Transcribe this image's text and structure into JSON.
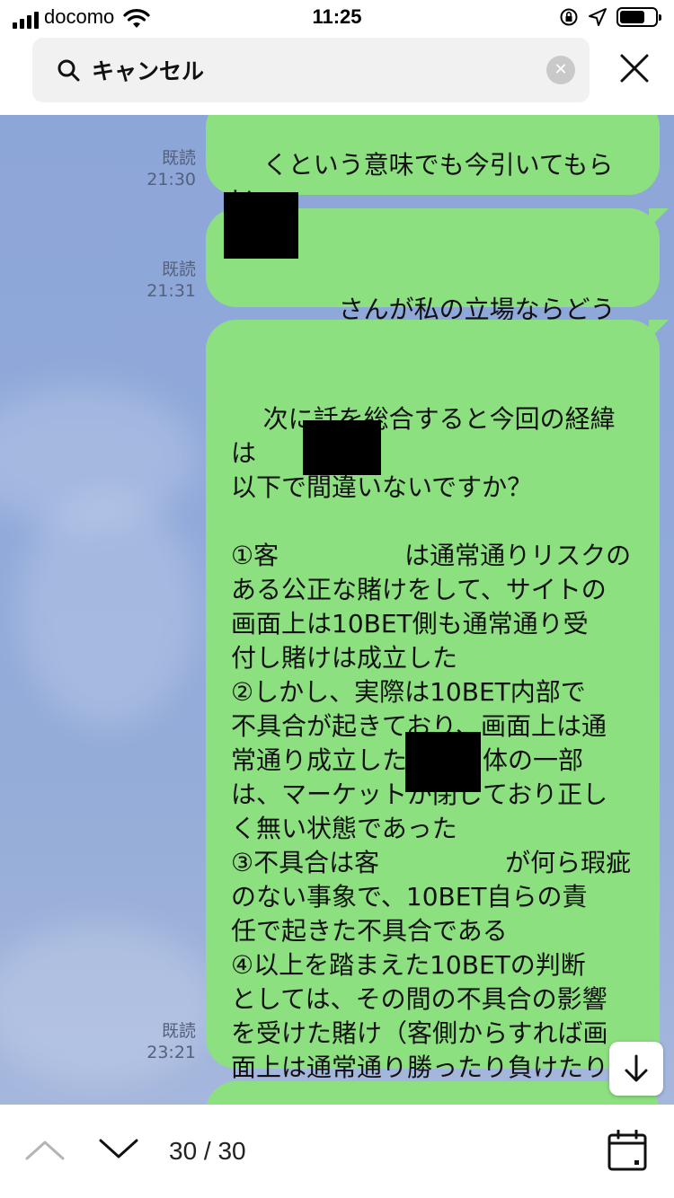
{
  "status_bar": {
    "carrier": "docomo",
    "time": "11:25",
    "battery_level": 0.7
  },
  "search": {
    "query": "キャンセル",
    "clear_icon": "clear-icon",
    "close_icon": "close-icon"
  },
  "messages": [
    {
      "read_label": "既読",
      "time": "21:30",
      "text": "くという意味でも今引いてもらい\nます。"
    },
    {
      "read_label": "既読",
      "time": "21:31",
      "text": "　　　さんが私の立場ならどうしま\nすか？"
    },
    {
      "read_label": "既読",
      "time": "23:21",
      "text": "次に話を総合すると今回の経緯は\n以下で間違いないですか？\n\n①客　　　　　は通常通りリスクの\nある公正な賭けをして、サイトの\n画面上は10BET側も通常通り受\n付し賭けは成立した\n②しかし、実際は10BET内部で\n不具合が起きており、画面上は通\n常通り成立した賭け自体の一部\nは、マーケットが閉じており正し\nく無い状態であった\n③不具合は客　　　　　が何ら瑕疵\nのない事象で、10BET自らの責\n任で起きた不具合である\n④以上を踏まえた10BETの判断\nとしては、その間の不具合の影響\nを受けた賭け（客側からすれば画\n面上は通常通り勝ったり負けたり\nした賭け）を全て無効とし、賭け\n金を返金した"
    }
  ],
  "bottom_bar": {
    "counter": "30 / 30"
  }
}
